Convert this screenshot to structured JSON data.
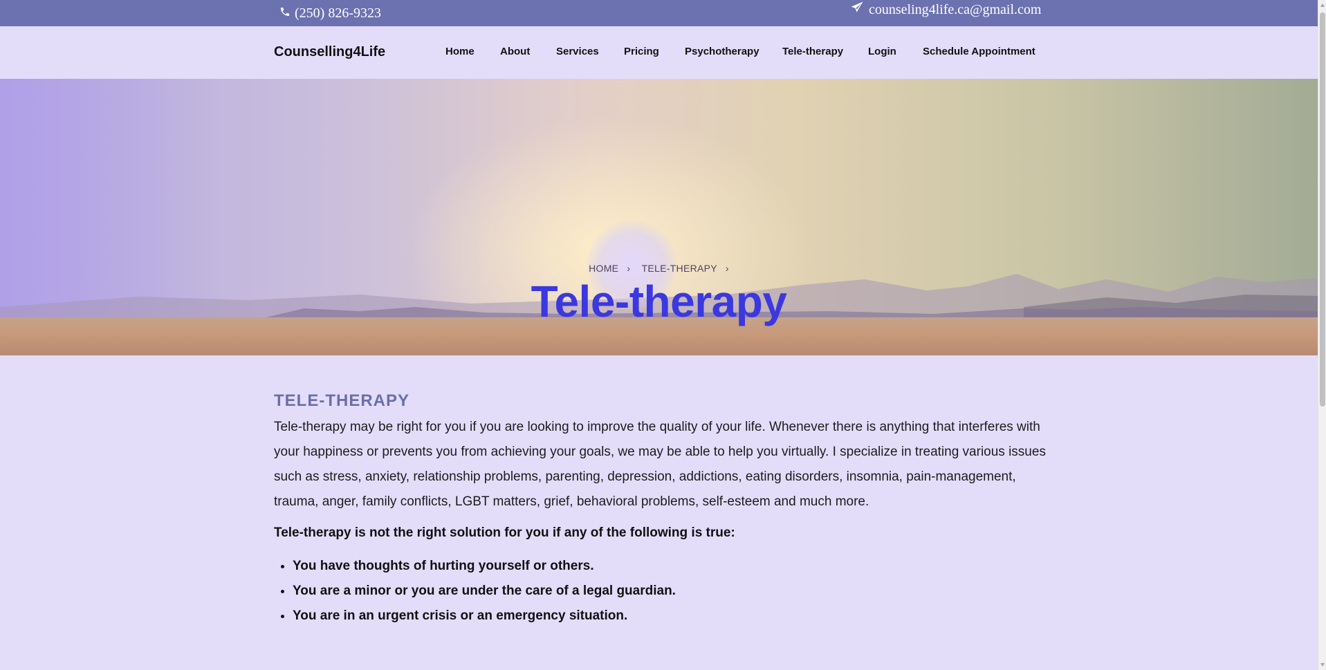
{
  "topbar": {
    "phone": "(250) 826-9323",
    "phone_icon": "phone-icon",
    "email": "counseling4life.ca@gmail.com",
    "email_icon": "paper-plane-icon"
  },
  "header": {
    "brand": "Counselling4Life",
    "nav": [
      "Home",
      "About",
      "Services",
      "Pricing",
      "Psychotherapy",
      "Tele-therapy",
      "Login",
      "Schedule Appointment"
    ]
  },
  "hero": {
    "breadcrumb": [
      "HOME",
      "TELE-THERAPY"
    ],
    "title": "Tele-therapy"
  },
  "main": {
    "heading": "TELE-THERAPY",
    "intro": "Tele-therapy may be right for you if you are looking to improve the quality of your life. Whenever there is anything that interferes with your happiness or prevents you from achieving your goals, we may be able to help you virtually. I specialize in treating various issues such as stress, anxiety, relationship problems, parenting, depression, addictions, eating disorders, insomnia, pain-management, trauma, anger, family conflicts, LGBT matters, grief, behavioral problems, self-esteem and much more.",
    "warning": "Tele-therapy is not the right solution for you if any of the following is true:",
    "conditions": [
      "You have thoughts of hurting yourself or others.",
      "You are a minor or you are under the care of a legal guardian.",
      "You are in an urgent crisis or an emergency situation."
    ]
  },
  "colors": {
    "topbar": "#6c71b0",
    "page_bg": "#e3ddfa",
    "hero_title": "#3b38e0",
    "section_heading": "#6b6fa8"
  }
}
